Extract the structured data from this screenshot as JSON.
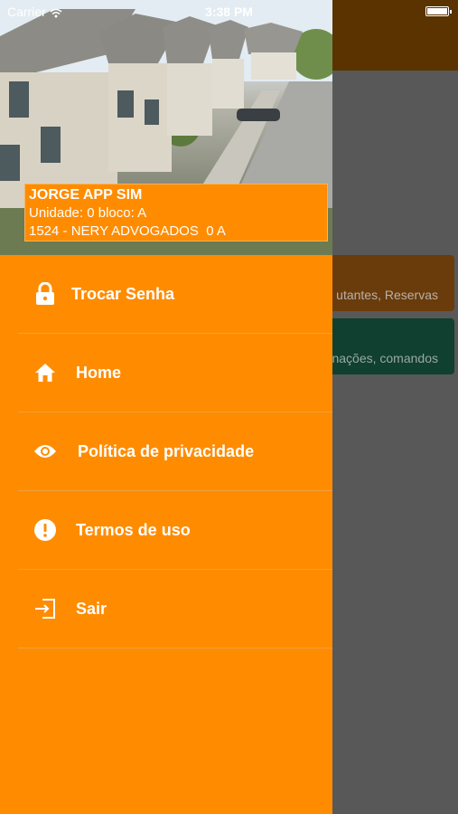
{
  "status_bar": {
    "carrier": "Carrier",
    "time": "3:38 PM"
  },
  "user": {
    "name": "JORGE APP SIM",
    "unit": "Unidade: 0 bloco: A",
    "company": "1524 - NERY ADVOGADOS  0 A"
  },
  "menu": [
    {
      "label": "Trocar Senha",
      "icon": "lock-icon"
    },
    {
      "label": "Home",
      "icon": "home-icon"
    },
    {
      "label": "Política de privacidade",
      "icon": "eye-icon"
    },
    {
      "label": "Termos de uso",
      "icon": "alert-circle-icon"
    },
    {
      "label": "Sair",
      "icon": "logout-icon"
    }
  ],
  "background_cards": [
    {
      "text": "utantes, Reservas"
    },
    {
      "text": "nações, comandos"
    }
  ],
  "colors": {
    "accent": "#ff8c00",
    "overlay": "#585858"
  }
}
